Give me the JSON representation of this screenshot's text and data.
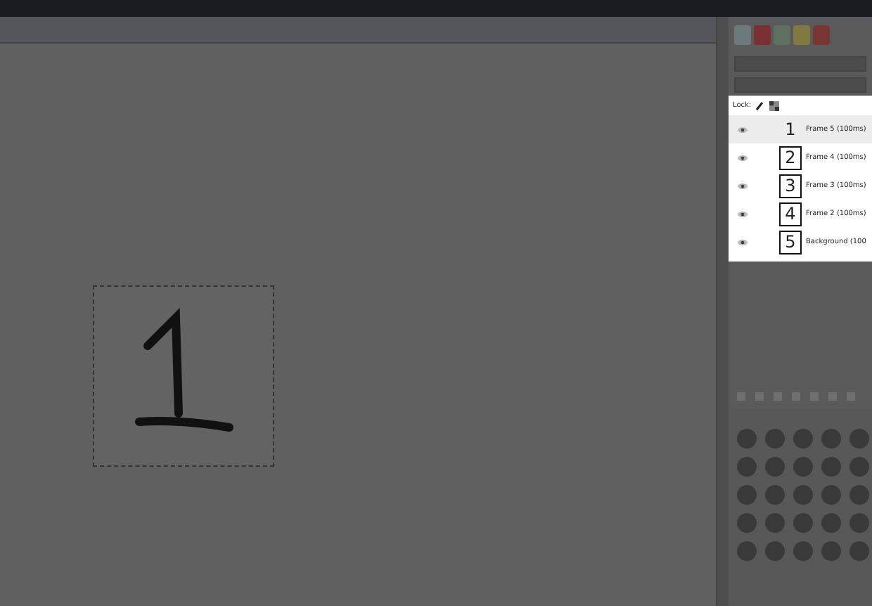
{
  "layers_panel": {
    "lock_label": "Lock:",
    "layers": [
      {
        "name": "Frame 5 (100ms)",
        "thumbnail_text": "1",
        "visible": true,
        "selected": true
      },
      {
        "name": "Frame 4 (100ms)",
        "thumbnail_text": "2",
        "visible": true,
        "selected": false
      },
      {
        "name": "Frame 3 (100ms)",
        "thumbnail_text": "3",
        "visible": true,
        "selected": false
      },
      {
        "name": "Frame 2 (100ms)",
        "thumbnail_text": "4",
        "visible": true,
        "selected": false
      },
      {
        "name": "Background (100",
        "thumbnail_text": "5",
        "visible": true,
        "selected": false
      }
    ]
  }
}
